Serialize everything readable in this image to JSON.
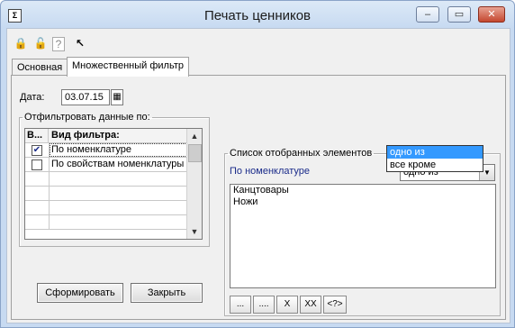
{
  "window": {
    "title": "Печать ценников",
    "icon": "Σ",
    "controls": {
      "minimize": "–",
      "maximize": "▭",
      "close": "✕"
    }
  },
  "toolbar": {
    "icons": [
      {
        "name": "lock-a-icon",
        "glyph": "🔒"
      },
      {
        "name": "lock-b-icon",
        "glyph": "🔓"
      },
      {
        "name": "help-doc-icon",
        "glyph": "?"
      },
      {
        "name": "pointer-help-icon",
        "glyph": "↖"
      }
    ]
  },
  "tabs": [
    {
      "label": "Основная",
      "active": false
    },
    {
      "label": "Множественный фильтр",
      "active": true
    }
  ],
  "date": {
    "label": "Дата:",
    "value": "03.07.15",
    "icon": "calendar-icon"
  },
  "filter_group": {
    "legend": "Отфильтровать данные по:",
    "columns": [
      "В...",
      "Вид фильтра:"
    ],
    "rows": [
      {
        "checked": true,
        "label": "По номенклатуре"
      },
      {
        "checked": false,
        "label": "По свойствам номенклатуры"
      }
    ]
  },
  "selected_group": {
    "legend": "Список отобранных элементов",
    "filter_name": "По номенклатуре",
    "combo_value": "одно из",
    "combo_options": [
      "одно из",
      "все кроме"
    ],
    "items": [
      "Канцтовары",
      "Ножи"
    ],
    "buttons": [
      "...",
      "....",
      "X",
      "XX",
      "<?>"
    ]
  },
  "buttons": {
    "generate": "Сформировать",
    "close": "Закрыть"
  },
  "colors": {
    "title_bar": "#c7daf1",
    "dropdown_highlight": "#3399ff",
    "filter_name_text": "#1a2b8a"
  }
}
